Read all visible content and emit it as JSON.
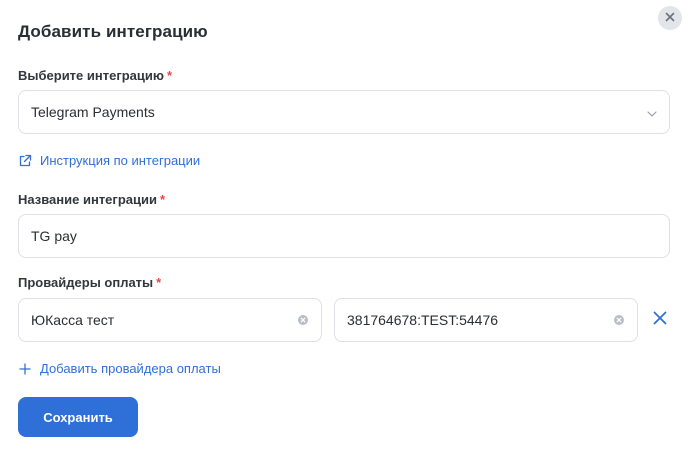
{
  "dialog": {
    "title": "Добавить интеграцию",
    "close_icon": "close-icon"
  },
  "integration_select": {
    "label": "Выберите интеграцию",
    "required_mark": "*",
    "value": "Telegram Payments",
    "icon": "chevron-down-icon"
  },
  "instruction_link": {
    "label": "Инструкция по интеграции",
    "icon": "external-link-icon"
  },
  "integration_name": {
    "label": "Название интеграции",
    "required_mark": "*",
    "value": "TG pay"
  },
  "payment_providers": {
    "label": "Провайдеры оплаты",
    "required_mark": "*",
    "provider_name": "ЮКасса тест",
    "provider_token": "381764678:TEST:54476",
    "clear_icon": "clear-circle-icon",
    "remove_icon": "close-icon"
  },
  "add_provider_link": {
    "label": "Добавить провайдера оплаты",
    "icon": "plus-icon"
  },
  "actions": {
    "save_label": "Сохранить"
  },
  "colors": {
    "accent": "#2f6fd8",
    "required": "#e5484d",
    "border": "#dde0e6",
    "close_bg": "#e3e5ea"
  }
}
